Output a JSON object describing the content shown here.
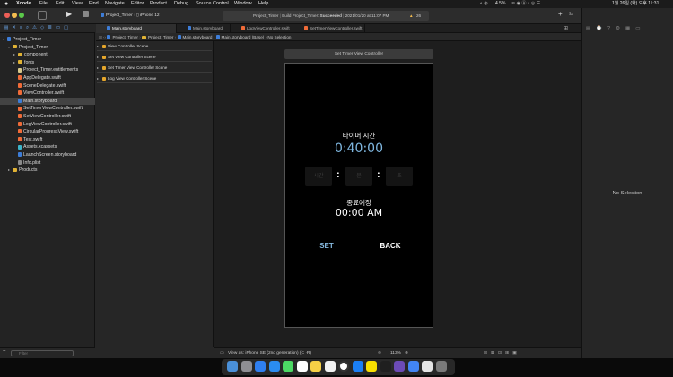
{
  "menubar": {
    "apple": "",
    "items": [
      "Xcode",
      "File",
      "Edit",
      "View",
      "Find",
      "Navigate",
      "Editor",
      "Product",
      "Debug",
      "Source Control",
      "Window",
      "Help"
    ],
    "status_right": "1월 26일 (화) 오후 11:31",
    "battery": "4.5%"
  },
  "toolbar": {
    "scheme": "Project_Timer",
    "device": "iPhone 12",
    "build_project": "Project_Timer",
    "build_text": "Build Project_Timer: ",
    "build_status": "Succeeded",
    "build_time": "2021/01/20 at 11:07 PM",
    "warnings": "26"
  },
  "navigator": {
    "rows": [
      {
        "label": "Project_Timer",
        "icon": "project-icon",
        "indent": 0,
        "disclosure": "▾"
      },
      {
        "label": "Project_Timer",
        "icon": "folder-icon",
        "indent": 1,
        "disclosure": "▾"
      },
      {
        "label": "component",
        "icon": "folder-icon",
        "indent": 2,
        "disclosure": "▸"
      },
      {
        "label": "fonts",
        "icon": "folder-icon",
        "indent": 2,
        "disclosure": "▸"
      },
      {
        "label": "Project_Timer.entitlements",
        "icon": "entitlements-icon",
        "indent": 2,
        "disclosure": ""
      },
      {
        "label": "AppDelegate.swift",
        "icon": "swift-file-icon",
        "indent": 2,
        "disclosure": ""
      },
      {
        "label": "SceneDelegate.swift",
        "icon": "swift-file-icon",
        "indent": 2,
        "disclosure": ""
      },
      {
        "label": "ViewController.swift",
        "icon": "swift-file-icon",
        "indent": 2,
        "disclosure": ""
      },
      {
        "label": "Main.storyboard",
        "icon": "storyboard-icon",
        "indent": 2,
        "disclosure": "",
        "selected": true
      },
      {
        "label": "SetTimerViewController.swift",
        "icon": "swift-file-icon",
        "indent": 2,
        "disclosure": ""
      },
      {
        "label": "SetViewController.swift",
        "icon": "swift-file-icon",
        "indent": 2,
        "disclosure": ""
      },
      {
        "label": "LogViewController.swift",
        "icon": "swift-file-icon",
        "indent": 2,
        "disclosure": ""
      },
      {
        "label": "CircularProgressView.swift",
        "icon": "swift-file-icon",
        "indent": 2,
        "disclosure": ""
      },
      {
        "label": "Test.swift",
        "icon": "swift-file-icon",
        "indent": 2,
        "disclosure": ""
      },
      {
        "label": "Assets.xcassets",
        "icon": "assets-icon",
        "indent": 2,
        "disclosure": ""
      },
      {
        "label": "LaunchScreen.storyboard",
        "icon": "storyboard-icon",
        "indent": 2,
        "disclosure": ""
      },
      {
        "label": "Info.plist",
        "icon": "plist-icon",
        "indent": 2,
        "disclosure": ""
      },
      {
        "label": "Products",
        "icon": "folder-icon",
        "indent": 1,
        "disclosure": "▸"
      }
    ],
    "filter_placeholder": "Filter"
  },
  "tabs": [
    {
      "label": "Main.storyboard",
      "active": true
    },
    {
      "label": "Main.storyboard",
      "active": false
    },
    {
      "label": "LogViewController.swift",
      "active": false
    },
    {
      "label": "SetTimerViewController.swift",
      "active": false
    }
  ],
  "jumpbar": [
    "Project_Timer",
    "Project_Timer",
    "Main.storyboard",
    "Main.storyboard (Base)",
    "No Selection"
  ],
  "outline": [
    "View Controller Scene",
    "Set View Controller Scene",
    "Set Timer View Controller Scene",
    "Log View Controller Scene"
  ],
  "canvas": {
    "scene_title": "Set Timer View Controller",
    "timer_title": "타이머 시간",
    "timer_value": "0:40:00",
    "pickers": [
      "시간",
      "분",
      "초"
    ],
    "colon": ":",
    "end_label": "종료예정",
    "end_time": "00:00 AM",
    "set_button": "SET",
    "back_button": "BACK"
  },
  "bottombar": {
    "view_as": "View as: iPhone SE (2nd generation) (",
    "shortcut": "C ·R)",
    "zoom": "113%",
    "filter_placeholder": "Filter"
  },
  "inspector": {
    "empty": "No Selection"
  },
  "dock": [
    "finder-icon",
    "launchpad-icon",
    "appstore-icon",
    "safari-icon",
    "messages-icon",
    "calendar-icon",
    "notes-icon",
    "reminders-icon",
    "clock-icon",
    "xcode-icon",
    "kakaotalk-icon",
    "terminal-icon",
    "github-desktop-icon",
    "chrome-icon",
    "notes-extra-icon",
    "trash-icon"
  ],
  "colors": {
    "accent": "#7fb7e0",
    "folder": "#e0b234",
    "swift": "#f06b38",
    "storyboard": "#3d7dd8"
  }
}
